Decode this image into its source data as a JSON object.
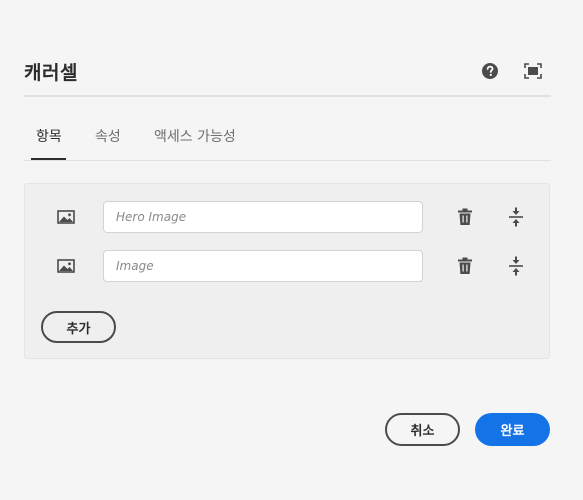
{
  "dialog": {
    "title": "캐러셀",
    "help_icon": "help-icon",
    "fullscreen_icon": "fullscreen-icon"
  },
  "tabs": [
    {
      "label": "항목",
      "selected": true
    },
    {
      "label": "속성",
      "selected": false
    },
    {
      "label": "액세스 가능성",
      "selected": false
    }
  ],
  "items": [
    {
      "icon": "image-icon",
      "placeholder": "Hero Image",
      "value": ""
    },
    {
      "icon": "image-icon",
      "placeholder": "Image",
      "value": ""
    }
  ],
  "item_actions": {
    "delete_icon": "trash-icon",
    "reorder_icon": "reorder-icon"
  },
  "panel": {
    "add_label": "추가"
  },
  "footer": {
    "cancel_label": "취소",
    "done_label": "완료"
  },
  "colors": {
    "primary": "#1473e6",
    "background": "#f5f5f5",
    "text": "#2c2c2c"
  }
}
